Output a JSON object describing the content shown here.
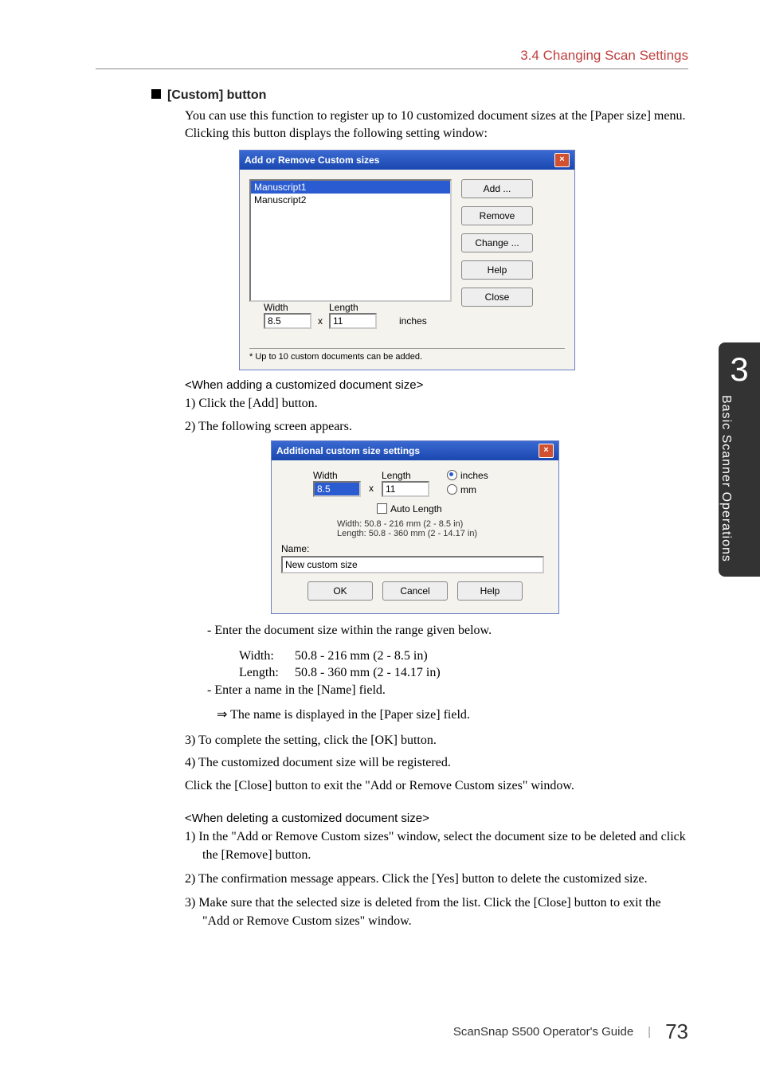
{
  "header": {
    "section": "3.4 Changing Scan Settings"
  },
  "section": {
    "title": "[Custom] button",
    "intro": "You can use this function to register up to 10 customized document sizes at the [Paper size] menu. Clicking this button displays the following setting window:"
  },
  "dialog1": {
    "title": "Add or Remove Custom sizes",
    "items": [
      "Manuscript1",
      "Manuscript2"
    ],
    "buttons": {
      "add": "Add ...",
      "remove": "Remove",
      "change": "Change ...",
      "help": "Help",
      "close": "Close"
    },
    "width_label": "Width",
    "length_label": "Length",
    "width_value": "8.5",
    "length_value": "11",
    "unit": "inches",
    "footnote": "* Up to 10 custom documents can be added."
  },
  "adding": {
    "heading": "<When adding a customized document size>",
    "step1": "1)  Click the [Add] button.",
    "step2": "2)  The following screen appears."
  },
  "dialog2": {
    "title": "Additional custom size settings",
    "width_label": "Width",
    "length_label": "Length",
    "width_value": "8.5",
    "length_value": "11",
    "unit_in": "inches",
    "unit_mm": "mm",
    "auto": "Auto Length",
    "range_w": "Width: 50.8 - 216 mm   (2 - 8.5 in)",
    "range_l": "Length: 50.8 - 360 mm   (2 - 14.17 in)",
    "name_label": "Name:",
    "name_value": "New custom size",
    "ok": "OK",
    "cancel": "Cancel",
    "help": "Help"
  },
  "ranges": {
    "intro": "- Enter the document size within the range given below.",
    "width_label": "Width:",
    "width_range": "50.8 - 216 mm (2 - 8.5 in)",
    "length_label": "Length:",
    "length_range": "50.8 - 360 mm (2 - 14.17 in)",
    "name_line": "- Enter a name in the [Name] field.",
    "arrow_line": "⇒ The name is displayed in the [Paper size] field."
  },
  "step3": "3)  To complete the setting, click the [OK] button.",
  "step4": "4)  The customized document size will be registered.",
  "close_line": "Click the [Close] button to exit the \"Add or Remove Custom sizes\" window.",
  "deleting": {
    "heading": "<When deleting a customized document size>",
    "step1": "1)  In the \"Add or Remove Custom sizes\" window, select the document size to be deleted and click the [Remove] button.",
    "step2": "2)  The confirmation message appears. Click the [Yes] button to delete the customized size.",
    "step3": "3)  Make sure that the selected size is deleted from the list. Click the [Close] button to exit the \"Add or Remove Custom sizes\" window."
  },
  "sidebar": {
    "chapter": "3",
    "label": "Basic Scanner Operations"
  },
  "footer": {
    "guide": "ScanSnap S500 Operator's Guide",
    "page": "73"
  }
}
